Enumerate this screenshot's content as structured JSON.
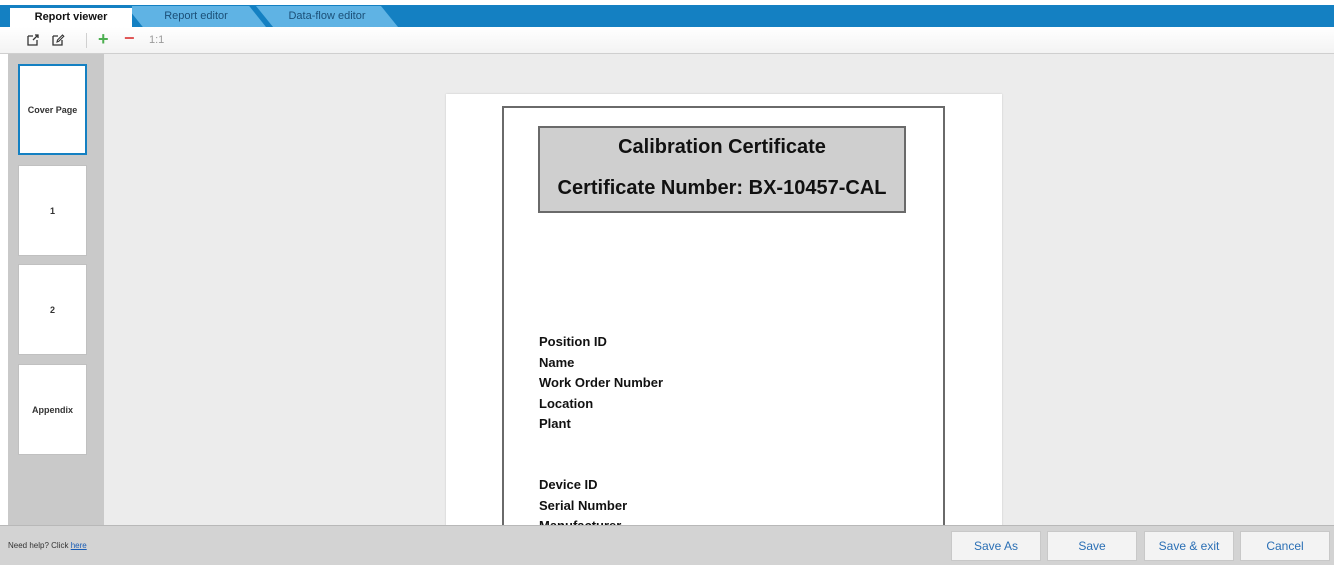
{
  "tabs": [
    {
      "label": "Report viewer",
      "active": true
    },
    {
      "label": "Report editor",
      "active": false
    },
    {
      "label": "Data-flow editor",
      "active": false
    }
  ],
  "toolbar": {
    "zoom_label": "1:1",
    "icons": [
      "export-icon",
      "edit-icon",
      "zoom-in-icon",
      "zoom-out-icon"
    ]
  },
  "sidebar": {
    "thumbnails": [
      {
        "label": "Cover Page",
        "selected": true
      },
      {
        "label": "1",
        "selected": false
      },
      {
        "label": "2",
        "selected": false
      },
      {
        "label": "Appendix",
        "selected": false
      }
    ]
  },
  "document": {
    "title": "Calibration Certificate",
    "certificate_number": "Certificate Number: BX-10457-CAL",
    "fields_group1": [
      "Position ID",
      "Name",
      "Work Order Number",
      "Location",
      "Plant"
    ],
    "fields_group2": [
      "Device ID",
      "Serial Number",
      "Manufacturer"
    ]
  },
  "footer": {
    "help_text": "Need help? Click ",
    "help_link": "here",
    "buttons": {
      "save_as": "Save As",
      "save": "Save",
      "save_exit": "Save & exit",
      "cancel": "Cancel"
    }
  },
  "colors": {
    "accent": "#1480c2",
    "inactive_tab": "#5fb3e4",
    "zoom_in": "#4caf50",
    "zoom_out": "#e05555"
  }
}
